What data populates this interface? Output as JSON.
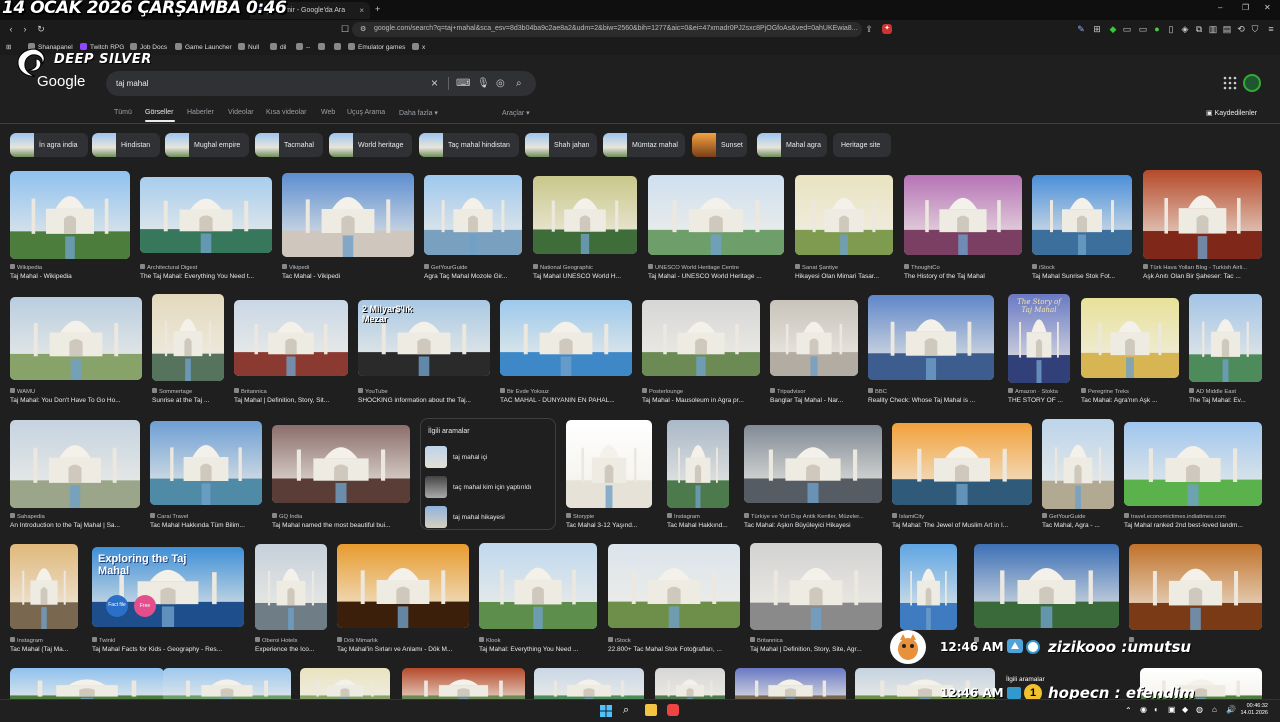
{
  "overlay": {
    "date_banner": "14 OCAK 2026 ÇARŞAMBA 0:46",
    "brand": "DEEP SILVER",
    "clock_1": "12:46 AM",
    "clock_2": "12:46 AM",
    "user_1": "zizikooo :umutsu",
    "user_2": "hopecn : efendim",
    "related_mini": "İlgili aramalar"
  },
  "browser": {
    "tabs": [
      {
        "label": "gui-i emir - Google'da Ara"
      }
    ],
    "new_tab": "+",
    "url": "google.com/search?q=taj+mahal&sca_esv=8d3b04ba9c2ae8a2&udm=2&biw=2560&bih=1277&aic=0&ei=47xmadr0PJ2sxc8PjOGfoAs&ved=0ahUKEwia8...",
    "bookmarks": [
      "Shanapanel",
      "Twitch RPG",
      "Job Docs",
      "Game Launcher",
      "Null",
      "dil",
      "--",
      "",
      "",
      "Emulator games",
      "x"
    ]
  },
  "google": {
    "logo": "Google",
    "query": "taj mahal",
    "tabs": [
      "Tümü",
      "Görseller",
      "Haberler",
      "Videolar",
      "Kısa videolar",
      "Web",
      "Uçuş Arama",
      "Daha fazla ▾"
    ],
    "tools": "Araçlar ▾",
    "saved": "Kaydedilenler",
    "chips": [
      "İn agra india",
      "Hindistan",
      "Mughal empire",
      "Tacmahal",
      "World heritage",
      "Taç mahal hindistan",
      "Shah jahan",
      "Mümtaz mahal",
      "Sunset",
      "Mahal agra",
      "Heritage site"
    ]
  },
  "related": {
    "header": "İlgili aramalar",
    "items": [
      "taj mahal içi",
      "taç mahal kim için yaptırıldı",
      "taj mahal hikayesi"
    ]
  },
  "results": [
    {
      "source": "Wikipedia",
      "title": "Taj Mahal - Wikipedia"
    },
    {
      "source": "Architectural Digest",
      "title": "The Taj Mahal: Everything You Need t..."
    },
    {
      "source": "Vikipedi",
      "title": "Tac Mahal - Vikipedi"
    },
    {
      "source": "GetYourGuide",
      "title": "Agra Taç Mahal Mozole Gir..."
    },
    {
      "source": "National Geographic",
      "title": "Taj Mahal UNESCO World H..."
    },
    {
      "source": "UNESCO World Heritage Centre",
      "title": "Taj Mahal - UNESCO World Heritage ..."
    },
    {
      "source": "Sanat Şantiye",
      "title": "Hikayesi Olan Mimari Tasar..."
    },
    {
      "source": "ThoughtCo",
      "title": "The History of the Taj Mahal"
    },
    {
      "source": "iStock",
      "title": "Taj Mahal Sunrise Stok Fot..."
    },
    {
      "source": "Türk Hava Yolları Blog - Turkish Airli...",
      "title": "Aşk Anıtı Olan Bir Şaheser: Tac ..."
    },
    {
      "source": "WAMU",
      "title": "Taj Mahal: You Don't Have To Go Ho..."
    },
    {
      "source": "Sommertage",
      "title": "Sunrise at the Taj ..."
    },
    {
      "source": "Britannica",
      "title": "Taj Mahal | Definition, Story, Sit..."
    },
    {
      "source": "YouTube",
      "title": "SHOCKING information about the Taj..."
    },
    {
      "source": "Bir Evde Yoksuz",
      "title": "TAC MAHAL - DÜNYANIN EN PAHAL..."
    },
    {
      "source": "Posterlounge",
      "title": "Taj Mahal - Mausoleum in Agra pr..."
    },
    {
      "source": "Tripadvisor",
      "title": "Banglar Taj Mahal - Nar..."
    },
    {
      "source": "BBC",
      "title": "Reality Check: Whose Taj Mahal is ..."
    },
    {
      "source": "Amazon · Stokta",
      "title": "THE STORY OF ..."
    },
    {
      "source": "Peregrine Treks",
      "title": "Tac Mahal: Agra'nın Aşk ..."
    },
    {
      "source": "AD Middle East",
      "title": "The Taj Mahal: Ev..."
    },
    {
      "source": "Sahapedia",
      "title": "An Introduction to the Taj Mahal | Sa..."
    },
    {
      "source": "Carai Travel",
      "title": "Tac Mahal Hakkında Tüm Bilim..."
    },
    {
      "source": "GQ India",
      "title": "Taj Mahal named the most beautiful bui..."
    },
    {
      "source": "Storypie",
      "title": "Tac Mahal 3-12 Yaşınd..."
    },
    {
      "source": "Instagram",
      "title": "Tac Mahal Hakkınd..."
    },
    {
      "source": "Türkiye ve Yurt Dışı Antik Kentler, Müzeler...",
      "title": "Tac Mahal: Aşkın Büyüleyici Hikayesi"
    },
    {
      "source": "IslamiCity",
      "title": "Taj Mahal: The Jewel of Muslim Art in I..."
    },
    {
      "source": "GetYourGuide",
      "title": "Tac Mahal, Agra - ..."
    },
    {
      "source": "travel.economictimes.indiatimes.com",
      "title": "Taj Mahal ranked 2nd best-loved landm..."
    },
    {
      "source": "Instagram",
      "title": "Tac Mahal (Taj Ma..."
    },
    {
      "source": "Twinkl",
      "title": "Taj Mahal Facts for Kids - Geography - Res..."
    },
    {
      "source": "Oberoi Hotels",
      "title": "Experience the Ico..."
    },
    {
      "source": "Dök Mimarlık",
      "title": "Taç Mahal'in Sırları ve Anlamı - Dök M..."
    },
    {
      "source": "Klook",
      "title": "Taj Mahal: Everything You Need ..."
    },
    {
      "source": "iStock",
      "title": "22.800+ Tac Mahal Stok Fotoğrafları, ..."
    },
    {
      "source": "Britannica",
      "title": "Taj Mahal | Definition, Story, Site, Agr..."
    },
    {
      "source": "",
      "title": ""
    },
    {
      "source": "",
      "title": ""
    },
    {
      "source": "",
      "title": ""
    }
  ],
  "thumb_texts": {
    "yt_overlay": "2 Milyar$'lık Mezar",
    "book_title": "The Story of Taj Mahal",
    "twinkl_title": "Exploring the Taj Mahal",
    "twinkl_badge1": "Fact file",
    "twinkl_badge2": "Free"
  },
  "taskbar": {
    "time": "00:46:32",
    "date": "14.01.2026"
  },
  "colors": {
    "background": "#1f1f1f",
    "accent": "#8ab4f8",
    "chip_bg": "#303134"
  }
}
